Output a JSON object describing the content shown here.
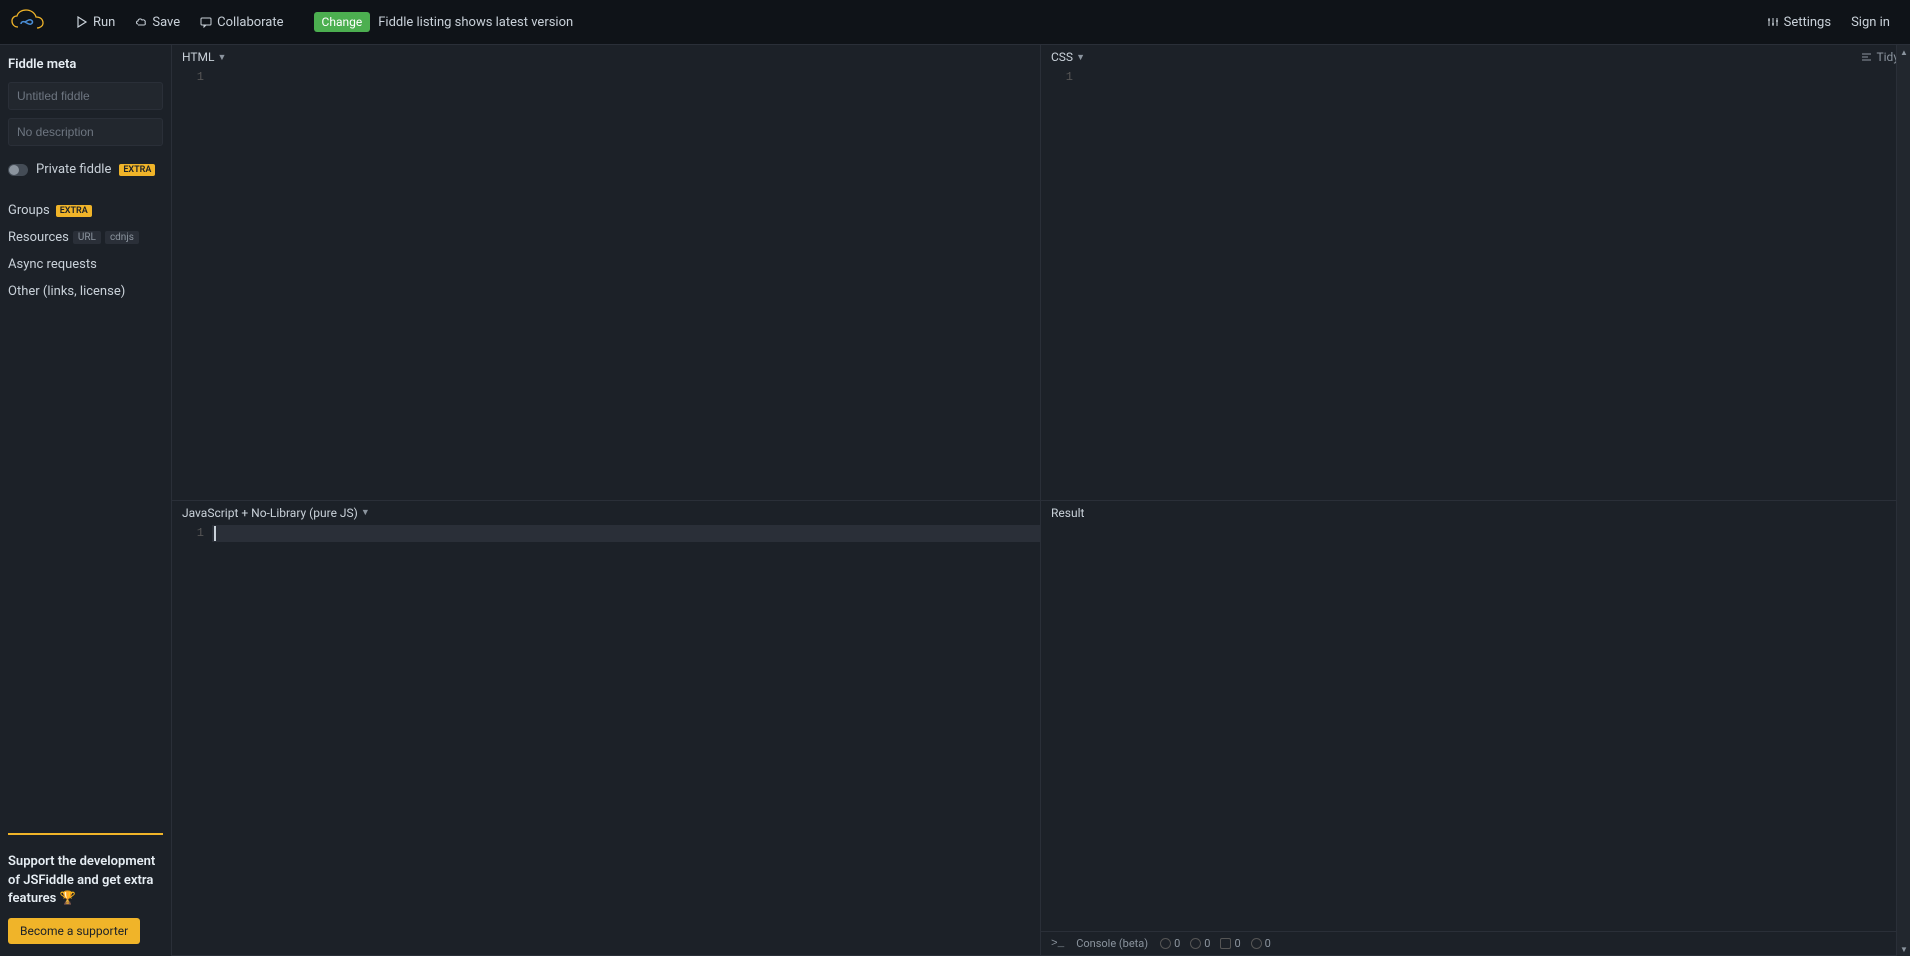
{
  "header": {
    "run": "Run",
    "save": "Save",
    "collaborate": "Collaborate",
    "change_badge": "Change",
    "notice": "Fiddle listing shows latest version",
    "settings": "Settings",
    "signin": "Sign in"
  },
  "sidebar": {
    "meta_title": "Fiddle meta",
    "title_placeholder": "Untitled fiddle",
    "desc_placeholder": "No description",
    "private_label": "Private fiddle",
    "extra_badge": "EXTRA",
    "groups_label": "Groups",
    "resources_label": "Resources",
    "url_badge": "URL",
    "cdnjs_badge": "cdnjs",
    "async_label": "Async requests",
    "other_label": "Other (links, license)",
    "support_text": "Support the development of JSFiddle and get extra features 🏆",
    "support_btn": "Become a supporter"
  },
  "panels": {
    "html_label": "HTML",
    "css_label": "CSS",
    "tidy_label": "Tidy",
    "js_label": "JavaScript + No-Library (pure JS)",
    "result_label": "Result",
    "line1": "1"
  },
  "console": {
    "label": "Console (beta)",
    "count_info": "0",
    "count_debug": "0",
    "count_warn": "0",
    "count_error": "0"
  }
}
